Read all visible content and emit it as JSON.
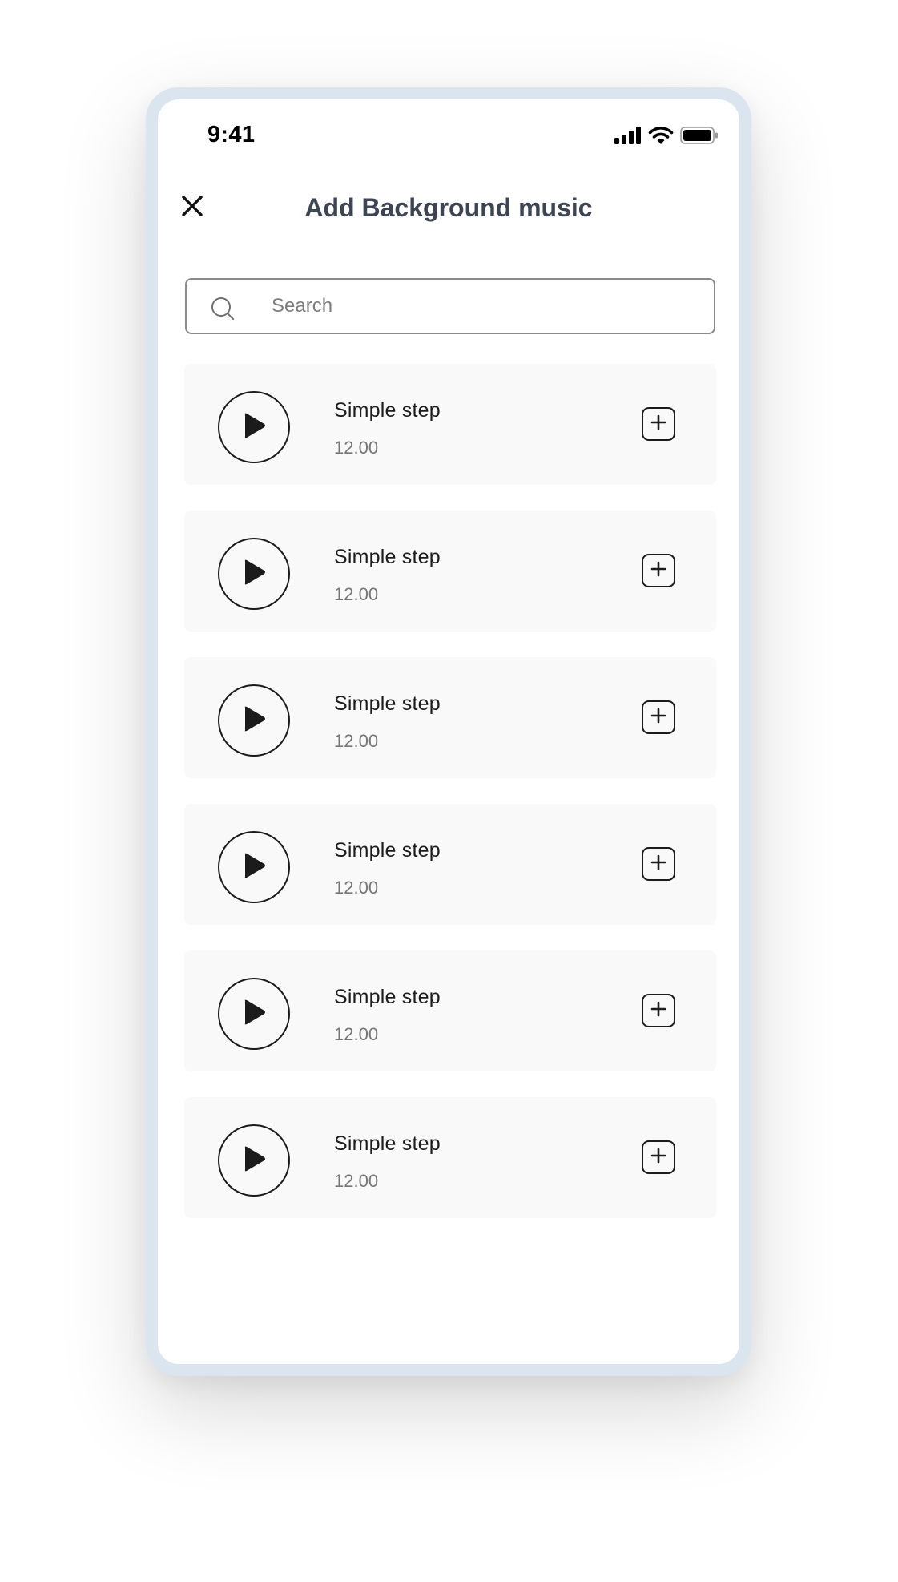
{
  "status_bar": {
    "time": "9:41"
  },
  "header": {
    "title": "Add Background music",
    "close_icon": "close-icon"
  },
  "search": {
    "placeholder": "Search",
    "value": "",
    "icon": "search-icon"
  },
  "tracks": [
    {
      "title": "Simple step",
      "duration": "12.00"
    },
    {
      "title": "Simple step",
      "duration": "12.00"
    },
    {
      "title": "Simple step",
      "duration": "12.00"
    },
    {
      "title": "Simple step",
      "duration": "12.00"
    },
    {
      "title": "Simple step",
      "duration": "12.00"
    },
    {
      "title": "Simple step",
      "duration": "12.00"
    }
  ],
  "colors": {
    "frame": "#dae5ef",
    "title_text": "#3d4454",
    "item_bg": "#f9f9f9",
    "icon_stroke": "#1b1b1b"
  }
}
